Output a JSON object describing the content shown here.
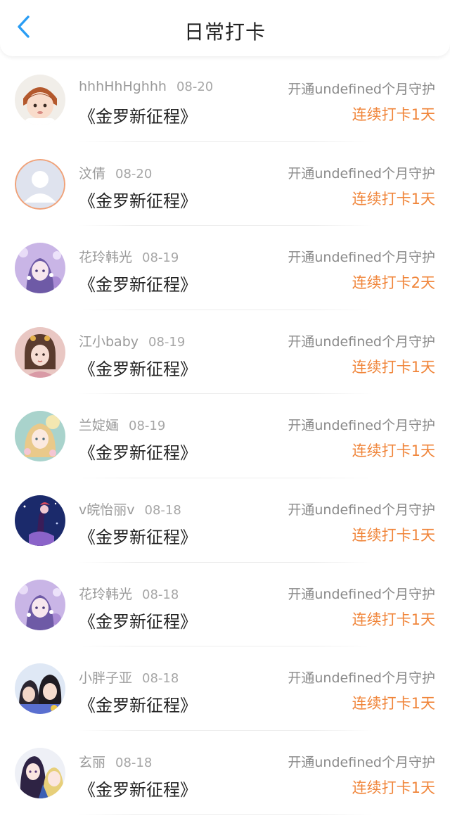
{
  "header": {
    "title": "日常打卡",
    "back_icon": "chevron-left-icon",
    "accent": "#2a9df4"
  },
  "colors": {
    "streak": "#f0853a",
    "muted": "#9a9a9a"
  },
  "entries": [
    {
      "name": "hhhHhHghhh",
      "date": "08-20",
      "book": "《金罗新征程》",
      "guard": "开通undefined个月守护",
      "streak": "连续打卡1天",
      "avatar": "baby-photo-avatar"
    },
    {
      "name": "汶倩",
      "date": "08-20",
      "book": "《金罗新征程》",
      "guard": "开通undefined个月守护",
      "streak": "连续打卡1天",
      "avatar": "default-user-avatar"
    },
    {
      "name": "花玲韩光",
      "date": "08-19",
      "book": "《金罗新征程》",
      "guard": "开通undefined个月守护",
      "streak": "连续打卡2天",
      "avatar": "anime-girl-lilac-avatar"
    },
    {
      "name": "江小baby",
      "date": "08-19",
      "book": "《金罗新征程》",
      "guard": "开通undefined个月守护",
      "streak": "连续打卡1天",
      "avatar": "illustrated-girl-pink-avatar"
    },
    {
      "name": "兰婝婳",
      "date": "08-19",
      "book": "《金罗新征程》",
      "guard": "开通undefined个月守护",
      "streak": "连续打卡1天",
      "avatar": "anime-girl-teal-avatar"
    },
    {
      "name": "v皖怡丽v",
      "date": "08-18",
      "book": "《金罗新征程》",
      "guard": "开通undefined个月守护",
      "streak": "连续打卡1天",
      "avatar": "dark-fantasy-avatar"
    },
    {
      "name": "花玲韩光",
      "date": "08-18",
      "book": "《金罗新征程》",
      "guard": "开通undefined个月守护",
      "streak": "连续打卡1天",
      "avatar": "anime-girl-lilac-avatar"
    },
    {
      "name": "小胖子亚",
      "date": "08-18",
      "book": "《金罗新征程》",
      "guard": "开通undefined个月守护",
      "streak": "连续打卡1天",
      "avatar": "two-girls-photo-avatar"
    },
    {
      "name": "玄丽",
      "date": "08-18",
      "book": "《金罗新征程》",
      "guard": "开通undefined个月守护",
      "streak": "连续打卡1天",
      "avatar": "anime-pair-avatar"
    }
  ]
}
